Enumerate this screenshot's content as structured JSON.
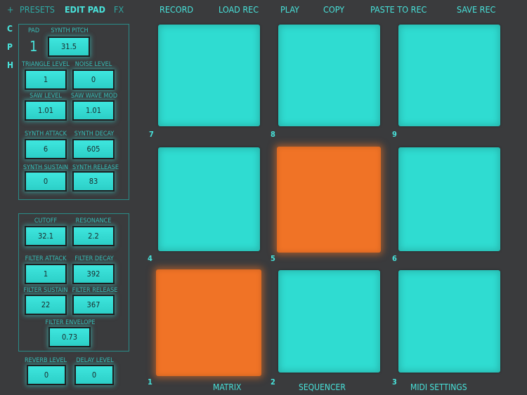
{
  "nav": {
    "plus": "+",
    "presets": "PRESETS",
    "edit_pad": "EDIT PAD",
    "fx": "FX"
  },
  "toolbar": {
    "record": "RECORD",
    "load_rec": "LOAD REC",
    "play": "PLAY",
    "copy": "COPY",
    "paste_to_rec": "PASTE TO REC",
    "save_rec": "SAVE REC"
  },
  "side_tabs": [
    "C",
    "P",
    "H"
  ],
  "synth": {
    "pad_label": "PAD",
    "pad_value": "1",
    "pitch_label": "SYNTH PITCH",
    "pitch_value": "31.5",
    "triangle_label": "TRIANGLE LEVEL",
    "triangle_value": "1",
    "noise_label": "NOISE LEVEL",
    "noise_value": "0",
    "saw_label": "SAW LEVEL",
    "saw_value": "1.01",
    "sawmod_label": "SAW WAVE MOD",
    "sawmod_value": "1.01",
    "attack_label": "SYNTH ATTACK",
    "attack_value": "6",
    "decay_label": "SYNTH DECAY",
    "decay_value": "605",
    "sustain_label": "SYNTH SUSTAIN",
    "sustain_value": "0",
    "release_label": "SYNTH RELEASE",
    "release_value": "83"
  },
  "filter": {
    "cutoff_label": "CUTOFF",
    "cutoff_value": "32.1",
    "resonance_label": "RESONANCE",
    "resonance_value": "2.2",
    "attack_label": "FILTER ATTACK",
    "attack_value": "1",
    "decay_label": "FILTER DECAY",
    "decay_value": "392",
    "sustain_label": "FILTER SUSTAIN",
    "sustain_value": "22",
    "release_label": "FILTER RELEASE",
    "release_value": "367",
    "envelope_label": "FILTER ENVELOPE",
    "envelope_value": "0.73"
  },
  "effects": {
    "reverb_label": "REVERB LEVEL",
    "reverb_value": "0",
    "delay_label": "DELAY LEVEL",
    "delay_value": "0"
  },
  "pads": {
    "p7": "7",
    "p8": "8",
    "p9": "9",
    "p4": "4",
    "p5": "5",
    "p6": "6",
    "p1": "1",
    "p2": "2",
    "p3": "3"
  },
  "bottom": {
    "matrix": "MATRIX",
    "sequencer": "SEQUENCER",
    "midi_settings": "MIDI SETTINGS"
  },
  "colors": {
    "pad_idle": "#2fdcd1",
    "pad_active": "#f07326",
    "background": "#3a3b3d"
  }
}
